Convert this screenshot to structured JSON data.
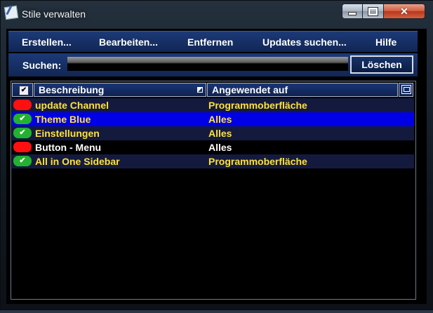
{
  "window": {
    "title": "Stile verwalten"
  },
  "menu": {
    "items": [
      {
        "label": "Erstellen..."
      },
      {
        "label": "Bearbeiten..."
      },
      {
        "label": "Entfernen"
      },
      {
        "label": "Updates suchen..."
      },
      {
        "label": "Hilfe"
      }
    ]
  },
  "search": {
    "label": "Suchen:",
    "value": "",
    "clear_label": "Löschen"
  },
  "table": {
    "columns": [
      {
        "label": "Beschreibung"
      },
      {
        "label": "Angewendet auf"
      }
    ],
    "rows": [
      {
        "status": "red",
        "description": "update Channel",
        "applied_to": "Programmoberfläche",
        "text_color": "#ffe23a",
        "background": "#141a3e"
      },
      {
        "status": "green",
        "description": "Theme Blue",
        "applied_to": "Alles",
        "text_color": "#ffe23a",
        "background": "#0000e6",
        "selected": true
      },
      {
        "status": "green",
        "description": "Einstellungen",
        "applied_to": "Alles",
        "text_color": "#ffe23a",
        "background": "#141a3e"
      },
      {
        "status": "red",
        "description": "Button - Menu",
        "applied_to": "Alles",
        "text_color": "#ffffff",
        "background": "#000000"
      },
      {
        "status": "green",
        "description": "All in One Sidebar",
        "applied_to": "Programmoberfläche",
        "text_color": "#ffe23a",
        "background": "#141a3e"
      }
    ]
  },
  "colors": {
    "status_red": "#ff1010",
    "status_green": "#22b230",
    "accent_blue": "#0000e6"
  }
}
